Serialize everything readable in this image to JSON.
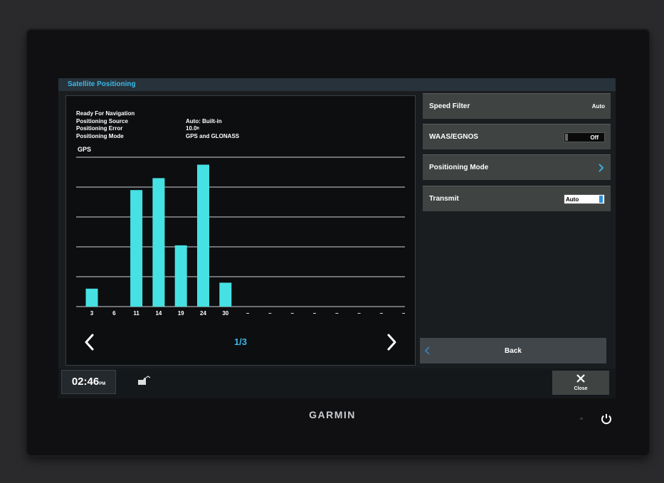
{
  "window": {
    "title": "Satellite Positioning"
  },
  "info": {
    "rows": [
      {
        "label": "Ready For Navigation",
        "value": ""
      },
      {
        "label": "Positioning Source",
        "value": "Auto: Built-in"
      },
      {
        "label": "Positioning Error",
        "value": "10.0"
      },
      {
        "label": "Positioning Mode",
        "value": "GPS and GLONASS"
      }
    ],
    "error_unit": "ft"
  },
  "gps_label": "GPS",
  "chart_data": {
    "type": "bar",
    "categories": [
      "3",
      "6",
      "11",
      "14",
      "19",
      "24",
      "30",
      "–",
      "–",
      "–",
      "–",
      "–",
      "–",
      "–",
      "–"
    ],
    "values": [
      12,
      0,
      78,
      86,
      41,
      95,
      16,
      0,
      0,
      0,
      0,
      0,
      0,
      0,
      0
    ],
    "ylim": [
      0,
      100
    ],
    "grid": true,
    "bar_color": "#46e1e3"
  },
  "pager": {
    "indicator": "1/3"
  },
  "menu": {
    "speed_filter": {
      "label": "Speed Filter",
      "value": "Auto"
    },
    "waas": {
      "label": "WAAS/EGNOS",
      "value": "Off"
    },
    "positioning_mode": {
      "label": "Positioning Mode"
    },
    "transmit": {
      "label": "Transmit",
      "value": "Auto"
    },
    "back": {
      "label": "Back"
    }
  },
  "status": {
    "time": "02:46",
    "ampm": "PM"
  },
  "close": {
    "label": "Close"
  },
  "brand": {
    "name": "GARMIN"
  },
  "colors": {
    "accent": "#3db8e8",
    "bar": "#46e1e3",
    "toggle_on": "#2f8fd8"
  }
}
